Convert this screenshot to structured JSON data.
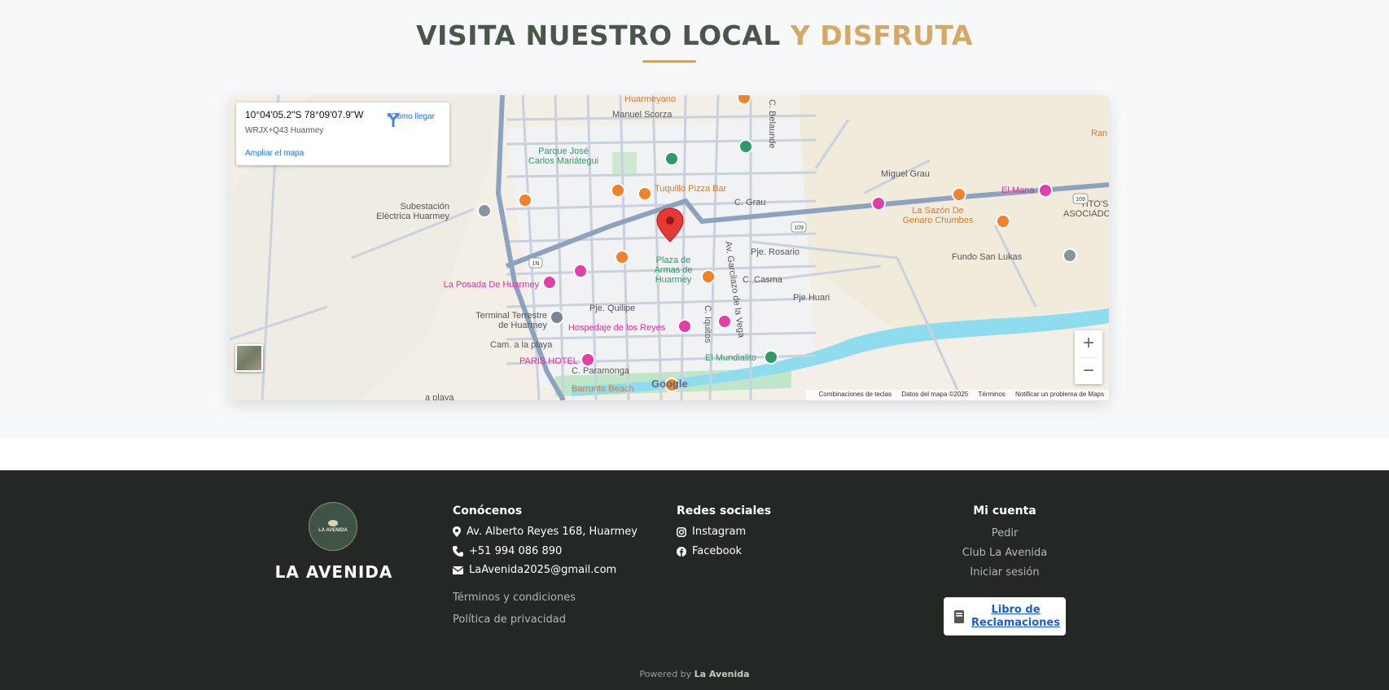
{
  "title": {
    "part1": "VISITA NUESTRO LOCAL",
    "part2": "Y DISFRUTA"
  },
  "map": {
    "coords": "10°04'05.2\"S 78°09'07.9\"W",
    "plus_code": "WRJX+Q43 Huarmey",
    "enlarge": "Ampliar el mapa",
    "directions": "Cómo llegar",
    "zoom_in": "+",
    "zoom_out": "−",
    "google_logo": "Google",
    "attribution": {
      "shortcuts": "Combinaciones de teclas",
      "data": "Datos del mapa ©2025",
      "terms": "Términos",
      "report": "Notificar un problema de Maps"
    },
    "labels": {
      "huarmeyano": "Huarmeyano",
      "manuel_scorza": "Manuel Scorza",
      "belaunde": "C. Belaunde",
      "parque": "Parque José",
      "parque2": "Carlos Mariátegui",
      "tuquillo": "Tuquillo Pizza Bar",
      "subestacion": "Subestación",
      "subestacion2": "Eléctrica Huarmey",
      "grau": "C. Grau",
      "miguel_grau": "Miguel Grau",
      "el_mana": "El Mana",
      "sazon": "La Sazón De",
      "sazon2": "Genaro Chumbes",
      "titos": "TITO'S",
      "titos2": "ASOCIADOS EIRL",
      "ran": "Ran",
      "fundo": "Fundo San Lukas",
      "plaza": "Plaza de",
      "plaza2": "Armas de",
      "plaza3": "Huarmey",
      "rosario": "Pje. Rosario",
      "casma": "C. Casma",
      "huari": "Pje Huari",
      "garcilazo": "Av. Garcilazo de la Vega",
      "posada": "La Posada De Huarmey",
      "quilipe": "Pje. Quilipe",
      "terminal": "Terminal Terrestre",
      "terminal2": "de Huarmey",
      "hospedaje": "Hospedaje de los Reyes",
      "iquitos": "C. Iquitos",
      "camplaya": "Cam. a la playa",
      "paris": "PARIS HOTEL",
      "paramonga": "C. Paramonga",
      "mundialito": "El Mundialito",
      "barrunto": "Barrunto Beach",
      "laplaya": "a playa",
      "r1n": "1N",
      "r109": "109",
      "r109b": "109"
    }
  },
  "footer": {
    "logo_text": "LA AVENIDA",
    "brand": "LA AVENIDA",
    "conocenos": {
      "heading": "Conócenos",
      "address": "Av. Alberto Reyes 168, Huarmey",
      "phone": "+51 994 086 890",
      "email": "LaAvenida2025@gmail.com",
      "terms": "Términos y condiciones",
      "privacy": "Política de privacidad"
    },
    "social": {
      "heading": "Redes sociales",
      "instagram": "Instagram",
      "facebook": "Facebook"
    },
    "account": {
      "heading": "Mi cuenta",
      "order": "Pedir",
      "club": "Club La Avenida",
      "login": "Iniciar sesión",
      "claims_line1": "Libro de",
      "claims_line2": "Reclamaciones"
    },
    "powered_prefix": "Powered by",
    "powered_brand": "La Avenida"
  },
  "colors": {
    "title_dark": "#4a5649",
    "title_gold": "#d3a965",
    "footer_bg": "#232824"
  }
}
